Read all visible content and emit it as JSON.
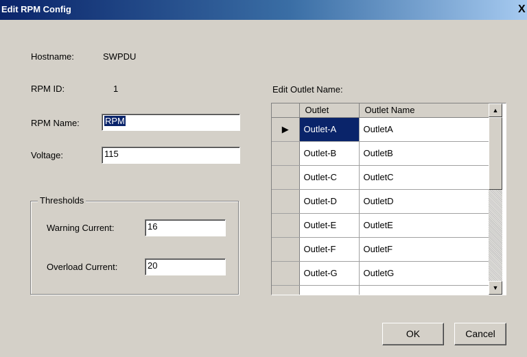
{
  "window": {
    "title": "Edit RPM Config",
    "close_glyph": "X"
  },
  "form": {
    "hostname_label": "Hostname:",
    "hostname_value": "SWPDU",
    "rpm_id_label": "RPM ID:",
    "rpm_id_value": "1",
    "rpm_name_label": "RPM Name:",
    "rpm_name_value": "RPM",
    "voltage_label": "Voltage:",
    "voltage_value": "115"
  },
  "thresholds": {
    "legend": "Thresholds",
    "warning_label": "Warning Current:",
    "warning_value": "16",
    "overload_label": "Overload Current:",
    "overload_value": "20"
  },
  "outlets": {
    "label": "Edit Outlet Name:",
    "columns": [
      "Outlet",
      "Outlet Name"
    ],
    "rows": [
      {
        "outlet": "Outlet-A",
        "name": "OutletA"
      },
      {
        "outlet": "Outlet-B",
        "name": "OutletB"
      },
      {
        "outlet": "Outlet-C",
        "name": "OutletC"
      },
      {
        "outlet": "Outlet-D",
        "name": "OutletD"
      },
      {
        "outlet": "Outlet-E",
        "name": "OutletE"
      },
      {
        "outlet": "Outlet-F",
        "name": "OutletF"
      },
      {
        "outlet": "Outlet-G",
        "name": "OutletG"
      },
      {
        "outlet": "",
        "name": ""
      }
    ],
    "current_row_marker": "▶"
  },
  "buttons": {
    "ok": "OK",
    "cancel": "Cancel"
  },
  "icons": {
    "scroll_up": "up-arrow-icon",
    "scroll_down": "down-arrow-icon",
    "row_pointer": "row-pointer-icon"
  },
  "colors": {
    "selection": "#0a246a",
    "dialog_bg": "#d4d0c8"
  }
}
